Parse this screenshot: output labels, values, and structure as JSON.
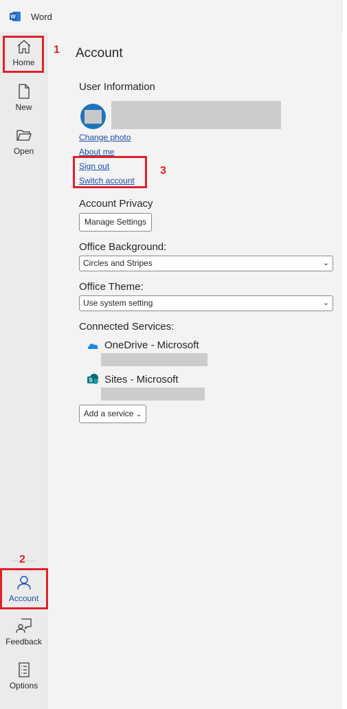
{
  "app": {
    "title": "Word"
  },
  "sidebar": {
    "items": [
      {
        "label": "Home",
        "icon": "home-icon"
      },
      {
        "label": "New",
        "icon": "new-document-icon"
      },
      {
        "label": "Open",
        "icon": "open-folder-icon"
      },
      {
        "label": "Account",
        "icon": "person-icon"
      },
      {
        "label": "Feedback",
        "icon": "feedback-icon"
      },
      {
        "label": "Options",
        "icon": "options-icon"
      }
    ]
  },
  "account": {
    "title": "Account",
    "user_info_heading": "User Information",
    "links": {
      "change_photo": "Change photo",
      "about_me": "About me",
      "sign_out": "Sign out",
      "switch_account": "Switch account"
    },
    "privacy_heading": "Account Privacy",
    "manage_settings": "Manage Settings",
    "background_heading": "Office Background:",
    "background_value": "Circles and Stripes",
    "theme_heading": "Office Theme:",
    "theme_value": "Use system setting",
    "services_heading": "Connected Services:",
    "services": [
      {
        "name": "OneDrive - Microsoft",
        "icon": "onedrive-cloud-icon"
      },
      {
        "name": "Sites - Microsoft",
        "icon": "sharepoint-icon"
      }
    ],
    "add_service": "Add a service"
  },
  "annotations": {
    "one": "1",
    "two": "2",
    "three": "3"
  },
  "colors": {
    "accent": "#1a4da6",
    "highlight": "#e0202a",
    "avatar": "#1e73be"
  }
}
